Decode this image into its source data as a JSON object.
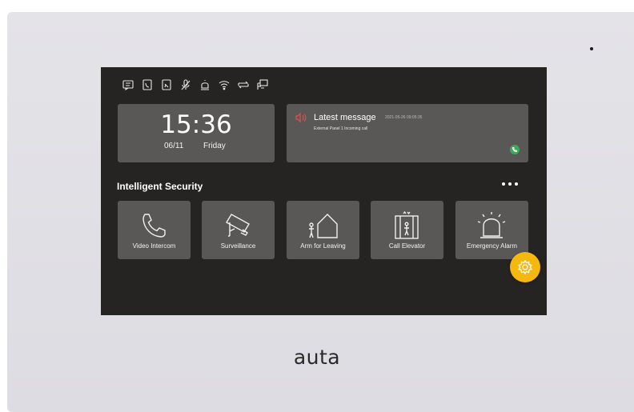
{
  "brand": "auta",
  "status_icons": [
    "message-icon",
    "call-log-icon",
    "missed-call-icon",
    "mute-icon",
    "alarm-icon",
    "wifi-icon",
    "transfer-icon",
    "network-icon"
  ],
  "clock": {
    "time": "15:36",
    "date": "06/11",
    "day": "Friday"
  },
  "message": {
    "title": "Latest message",
    "timestamp": "2021-05-26 09:05:35",
    "body": "External Panel 1 Incoming call"
  },
  "section": {
    "title": "Intelligent Security"
  },
  "tiles": [
    {
      "label": "Video Intercom",
      "icon": "phone-icon"
    },
    {
      "label": "Surveillance",
      "icon": "camera-icon"
    },
    {
      "label": "Arm for Leaving",
      "icon": "arm-home-icon"
    },
    {
      "label": "Call Elevator",
      "icon": "elevator-icon"
    },
    {
      "label": "Emergency Alarm",
      "icon": "siren-icon"
    }
  ],
  "colors": {
    "screen_bg": "#262422",
    "card_bg": "#5a5856",
    "accent_yellow": "#f5b80f",
    "alert_red": "#d9534f",
    "call_green": "#3fa95a"
  }
}
